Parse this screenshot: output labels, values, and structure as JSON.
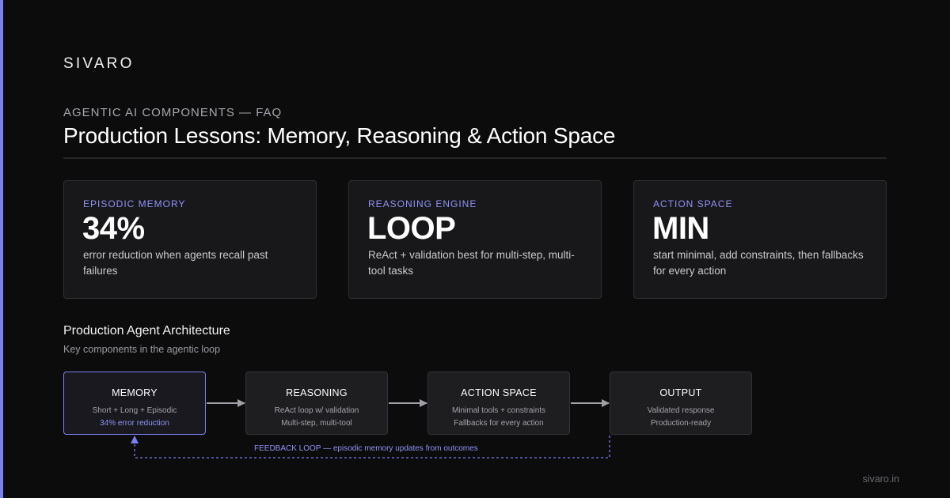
{
  "brand": "SIVARO",
  "header": {
    "eyebrow": "AGENTIC AI COMPONENTS — FAQ",
    "title": "Production Lessons: Memory, Reasoning & Action Space"
  },
  "cards": [
    {
      "label": "EPISODIC MEMORY",
      "value": "34%",
      "desc": "error reduction when agents recall past failures"
    },
    {
      "label": "REASONING ENGINE",
      "value": "LOOP",
      "desc": "ReAct + validation best for multi-step, multi-tool tasks"
    },
    {
      "label": "ACTION SPACE",
      "value": "MIN",
      "desc": "start minimal, add constraints, then fallbacks for every action"
    }
  ],
  "architecture": {
    "title": "Production Agent Architecture",
    "subtitle": "Key components in the agentic loop",
    "nodes": [
      {
        "title": "MEMORY",
        "line1": "Short + Long + Episodic",
        "line2": "34% error reduction"
      },
      {
        "title": "REASONING",
        "line1": "ReAct loop w/ validation",
        "line2": "Multi-step, multi-tool"
      },
      {
        "title": "ACTION SPACE",
        "line1": "Minimal tools + constraints",
        "line2": "Fallbacks for every action"
      },
      {
        "title": "OUTPUT",
        "line1": "Validated response",
        "line2": "Production-ready"
      }
    ],
    "feedback_label": "FEEDBACK LOOP — episodic memory updates from outcomes"
  },
  "footer": {
    "domain": "sivaro.in"
  },
  "colors": {
    "accent": "#7b7ff0",
    "background": "#0c0c0d",
    "card": "#18181a",
    "node": "#1e1e21",
    "arrow": "#a0a0a8"
  }
}
